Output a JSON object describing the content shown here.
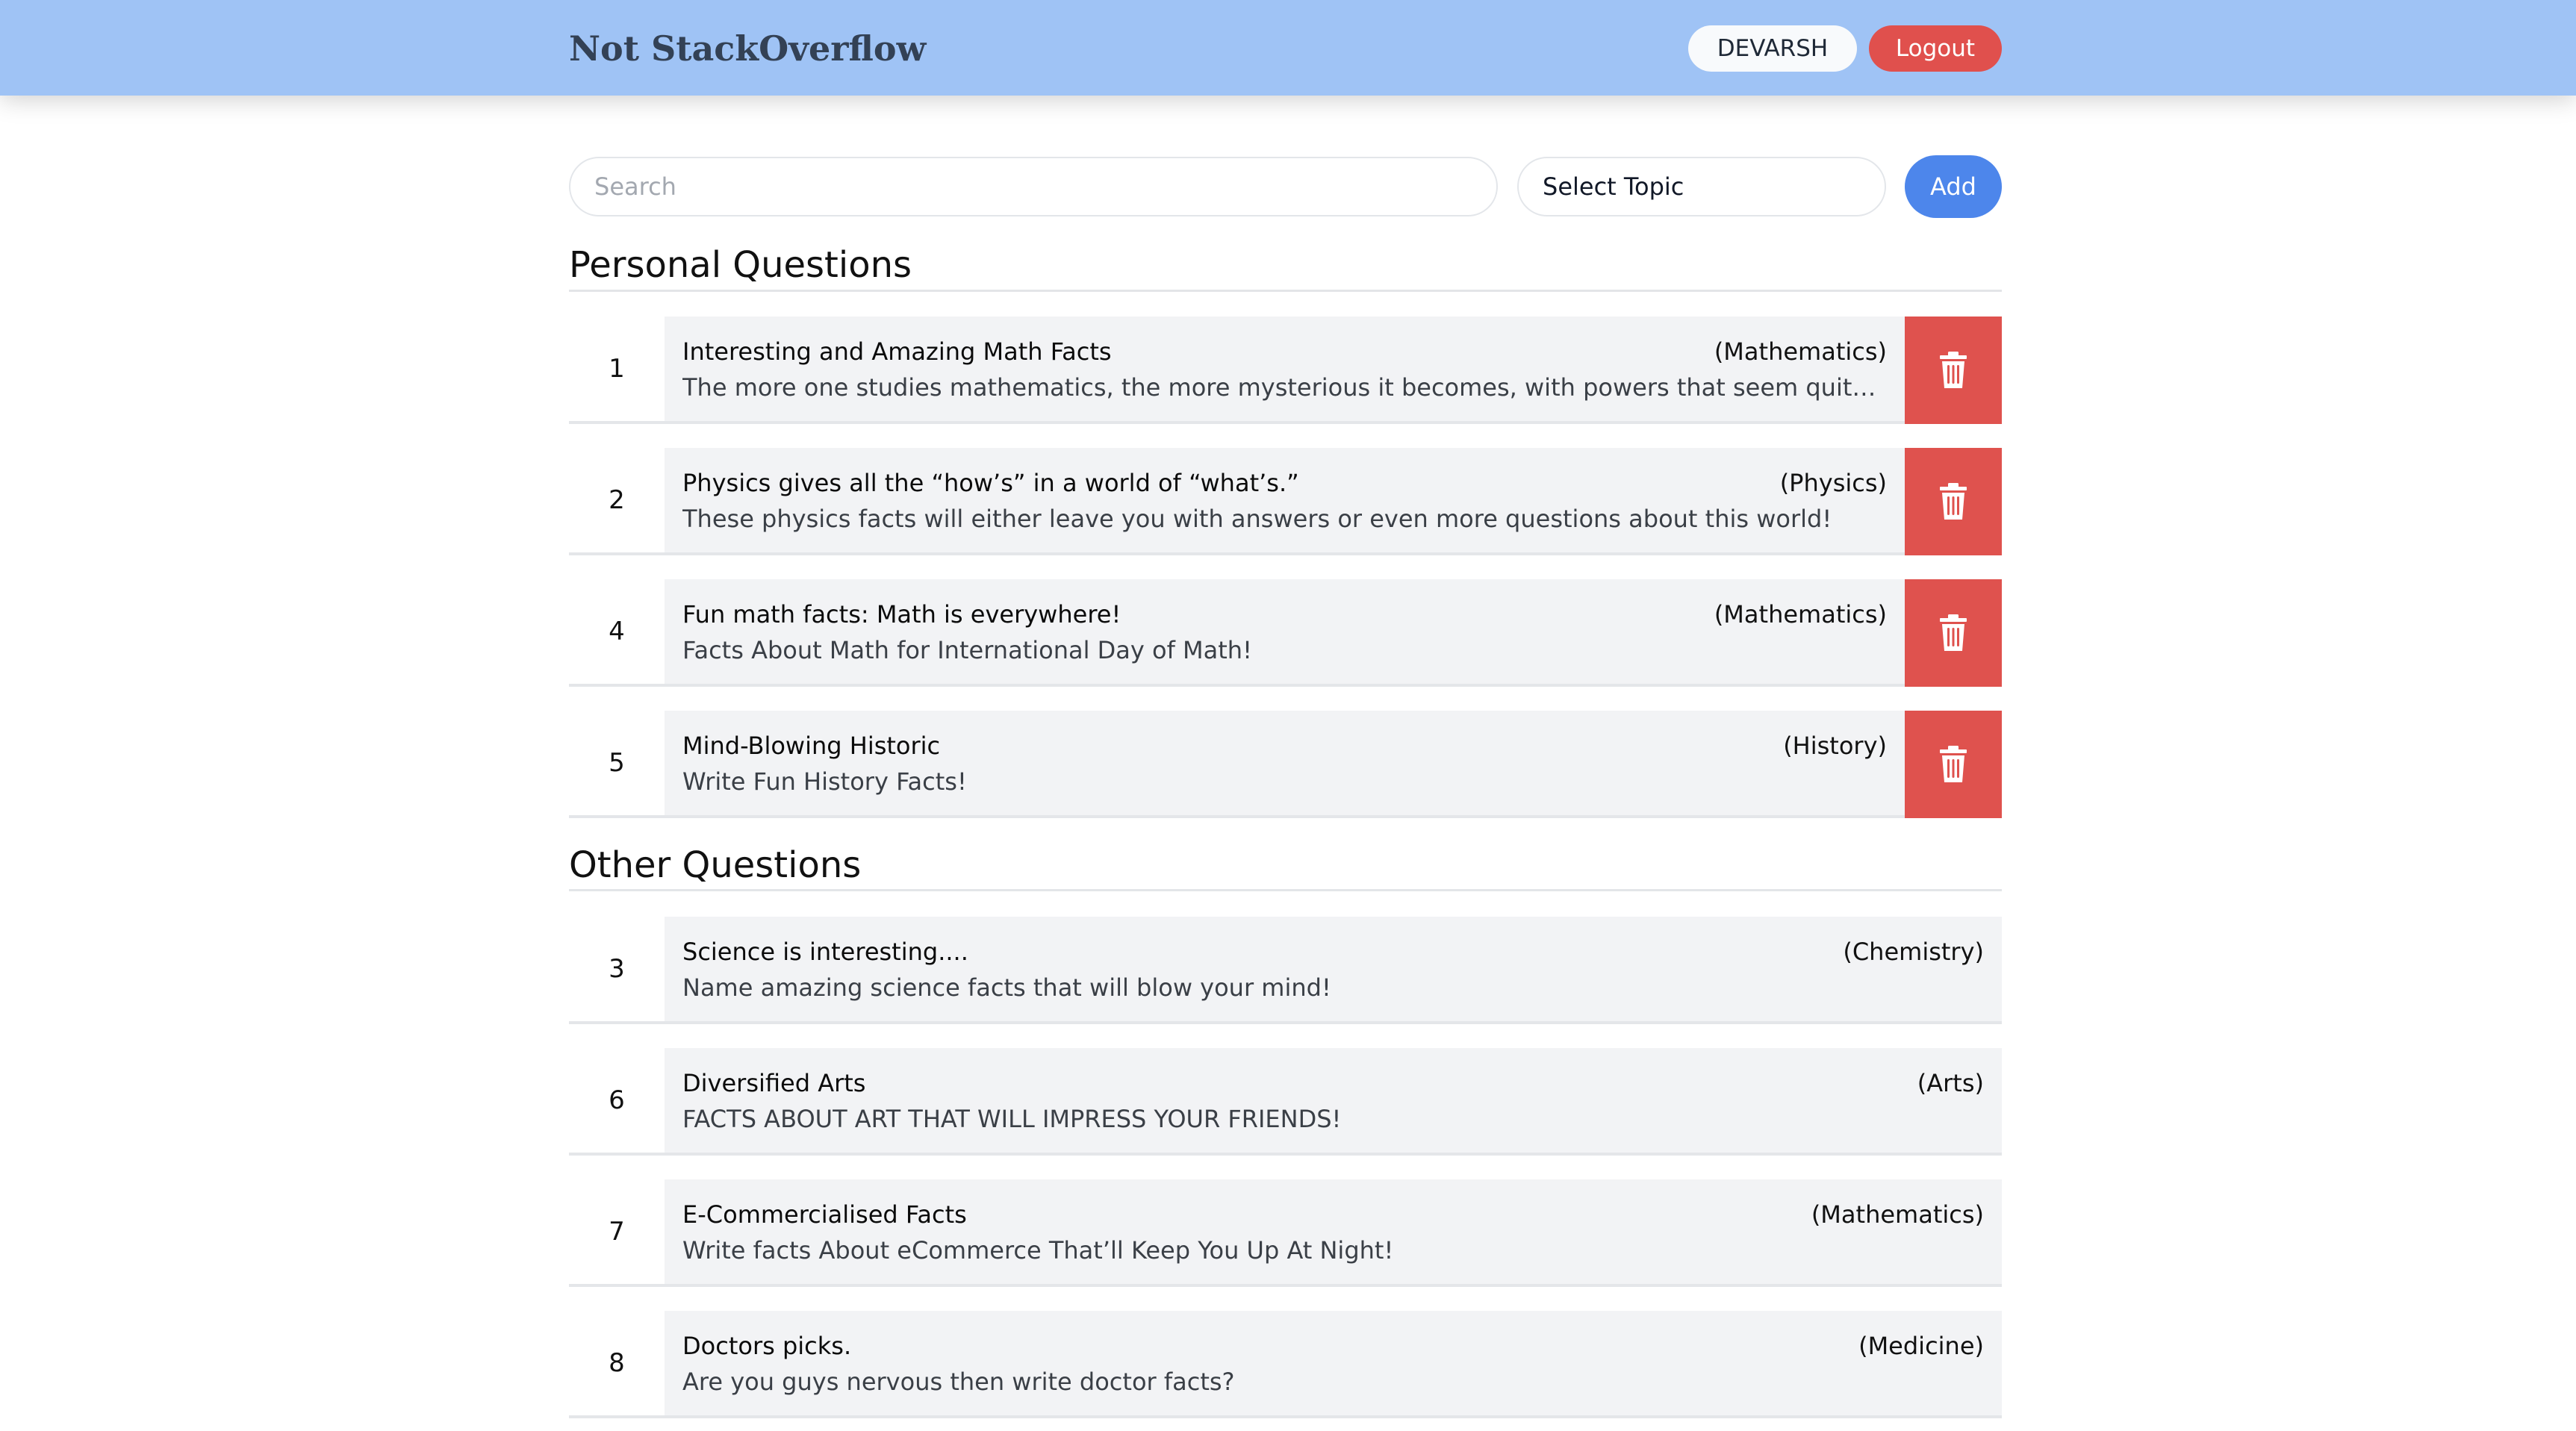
{
  "header": {
    "brand": "Not StackOverflow",
    "user_label": "DEVARSH",
    "logout_label": "Logout"
  },
  "toolbar": {
    "search_placeholder": "Search",
    "topic_select_value": "Select Topic",
    "add_label": "Add"
  },
  "personal": {
    "title": "Personal Questions",
    "items": [
      {
        "num": "1",
        "title": "Interesting and Amazing Math Facts",
        "topic": "(Mathematics)",
        "desc": "The more one studies mathematics, the more mysterious it becomes, with powers that seem quite \"..."
      },
      {
        "num": "2",
        "title": "Physics gives all the “how’s” in a world of “what’s.”",
        "topic": "(Physics)",
        "desc": "These physics facts will either leave you with answers or even more questions about this world!"
      },
      {
        "num": "4",
        "title": "Fun math facts: Math is everywhere!",
        "topic": "(Mathematics)",
        "desc": "Facts About Math for International Day of Math!"
      },
      {
        "num": "5",
        "title": "Mind-Blowing Historic",
        "topic": "(History)",
        "desc": "Write Fun History Facts!"
      }
    ]
  },
  "other": {
    "title": "Other Questions",
    "items": [
      {
        "num": "3",
        "title": "Science is interesting....",
        "topic": "(Chemistry)",
        "desc": "Name amazing science facts that will blow your mind!"
      },
      {
        "num": "6",
        "title": "Diversified Arts",
        "topic": "(Arts)",
        "desc": "FACTS ABOUT ART THAT WILL IMPRESS YOUR FRIENDS!"
      },
      {
        "num": "7",
        "title": "E-Commercialised Facts",
        "topic": "(Mathematics)",
        "desc": "Write facts About eCommerce That’ll Keep You Up At Night!"
      },
      {
        "num": "8",
        "title": "Doctors picks.",
        "topic": "(Medicine)",
        "desc": "Are you guys nervous then write doctor facts?"
      }
    ]
  },
  "icons": {
    "delete": "trash-icon"
  },
  "colors": {
    "navbar": "#9fc3f5",
    "delete": "#df524e",
    "add": "#4d86eb",
    "logout": "#e0504d"
  }
}
